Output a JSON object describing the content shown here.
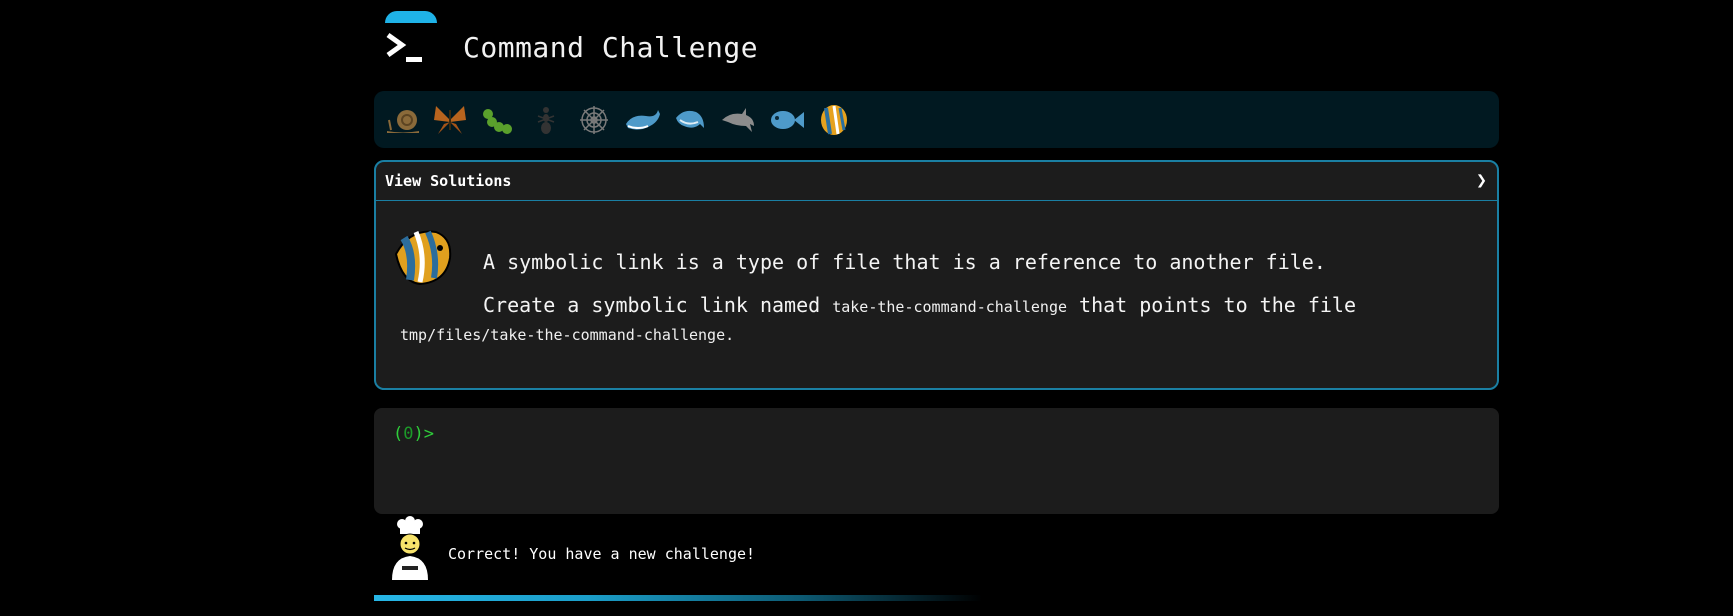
{
  "header": {
    "title": "Command Challenge"
  },
  "levels": [
    {
      "name": "snail",
      "color": "#8a6a3a"
    },
    {
      "name": "butterfly",
      "color": "#b8641e"
    },
    {
      "name": "caterpillar",
      "color": "#5aa02c"
    },
    {
      "name": "ant",
      "color": "#333333"
    },
    {
      "name": "spider-web",
      "color": "#7a7a7a"
    },
    {
      "name": "whale",
      "color": "#4e9ac9"
    },
    {
      "name": "shark",
      "color": "#4e9ac9"
    },
    {
      "name": "dolphin",
      "color": "#8c8c8c"
    },
    {
      "name": "fish",
      "color": "#4e9ac9"
    },
    {
      "name": "tropical-fish",
      "color": "#e6a21e"
    }
  ],
  "challenge": {
    "view_solutions_label": "View Solutions",
    "chevron": "❯",
    "description": "A symbolic link is a type of file that is a reference to another file.",
    "task_part1": "Create a symbolic link named ",
    "task_code1": "take-the-command-challenge",
    "task_part2": " that points to the file ",
    "task_code2": "tmp/files/take-the-command-challenge",
    "task_end": "."
  },
  "terminal": {
    "prompt_open": "(",
    "prompt_count": "0",
    "prompt_close": ")>"
  },
  "feedback": {
    "message": "Correct! You have a new challenge!"
  },
  "progress": {
    "fraction": 0.54
  },
  "colors": {
    "accent": "#1fb3e8",
    "prompt": "#2ecc3a",
    "panel_border": "#1a7fa3"
  }
}
